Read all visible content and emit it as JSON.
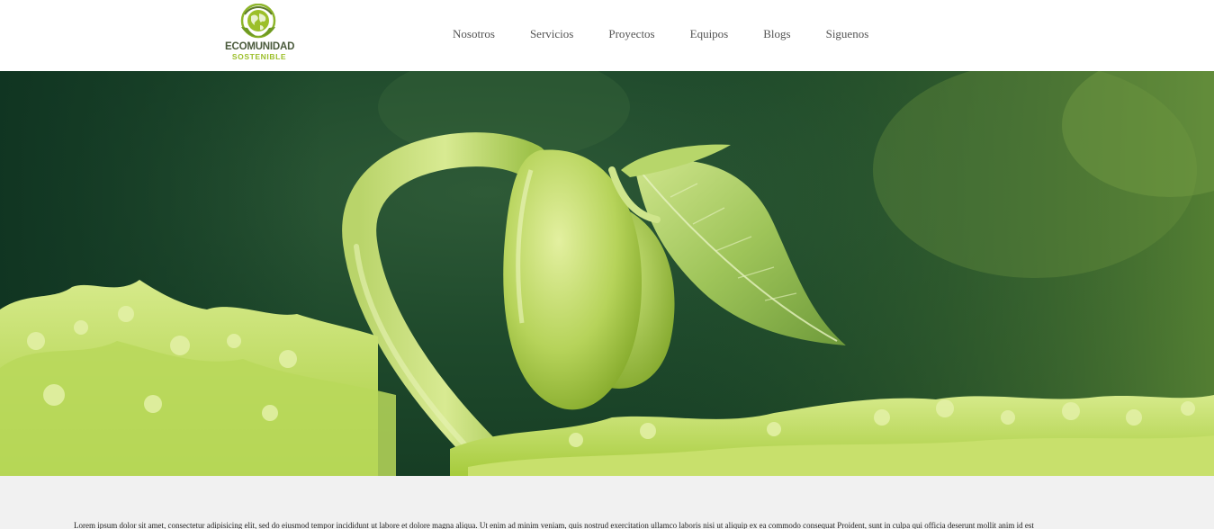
{
  "brand": {
    "name": "ECOMUNIDAD",
    "tagline": "SOSTENIBLE",
    "logo_icon": "globe-leaf-icon",
    "colors": {
      "primary_green": "#9cbf2a",
      "dark_text": "#4a5a3c"
    }
  },
  "nav": {
    "items": [
      {
        "label": "Nosotros"
      },
      {
        "label": "Servicios"
      },
      {
        "label": "Proyectos"
      },
      {
        "label": "Equipos"
      },
      {
        "label": "Blogs"
      },
      {
        "label": "Siguenos"
      }
    ]
  },
  "hero": {
    "image": "sprouting-bean-seedling-photo"
  },
  "content": {
    "paragraph": "Lorem ipsum dolor sit amet, consectetur adipisicing elit, sed do eiusmod tempor incididunt ut labore et dolore magna aliqua. Ut enim ad minim veniam, quis nostrud exercitation ullamco laboris nisi ut aliquip ex ea commodo consequat Proident, sunt in culpa qui officia deserunt mollit anim id est"
  }
}
